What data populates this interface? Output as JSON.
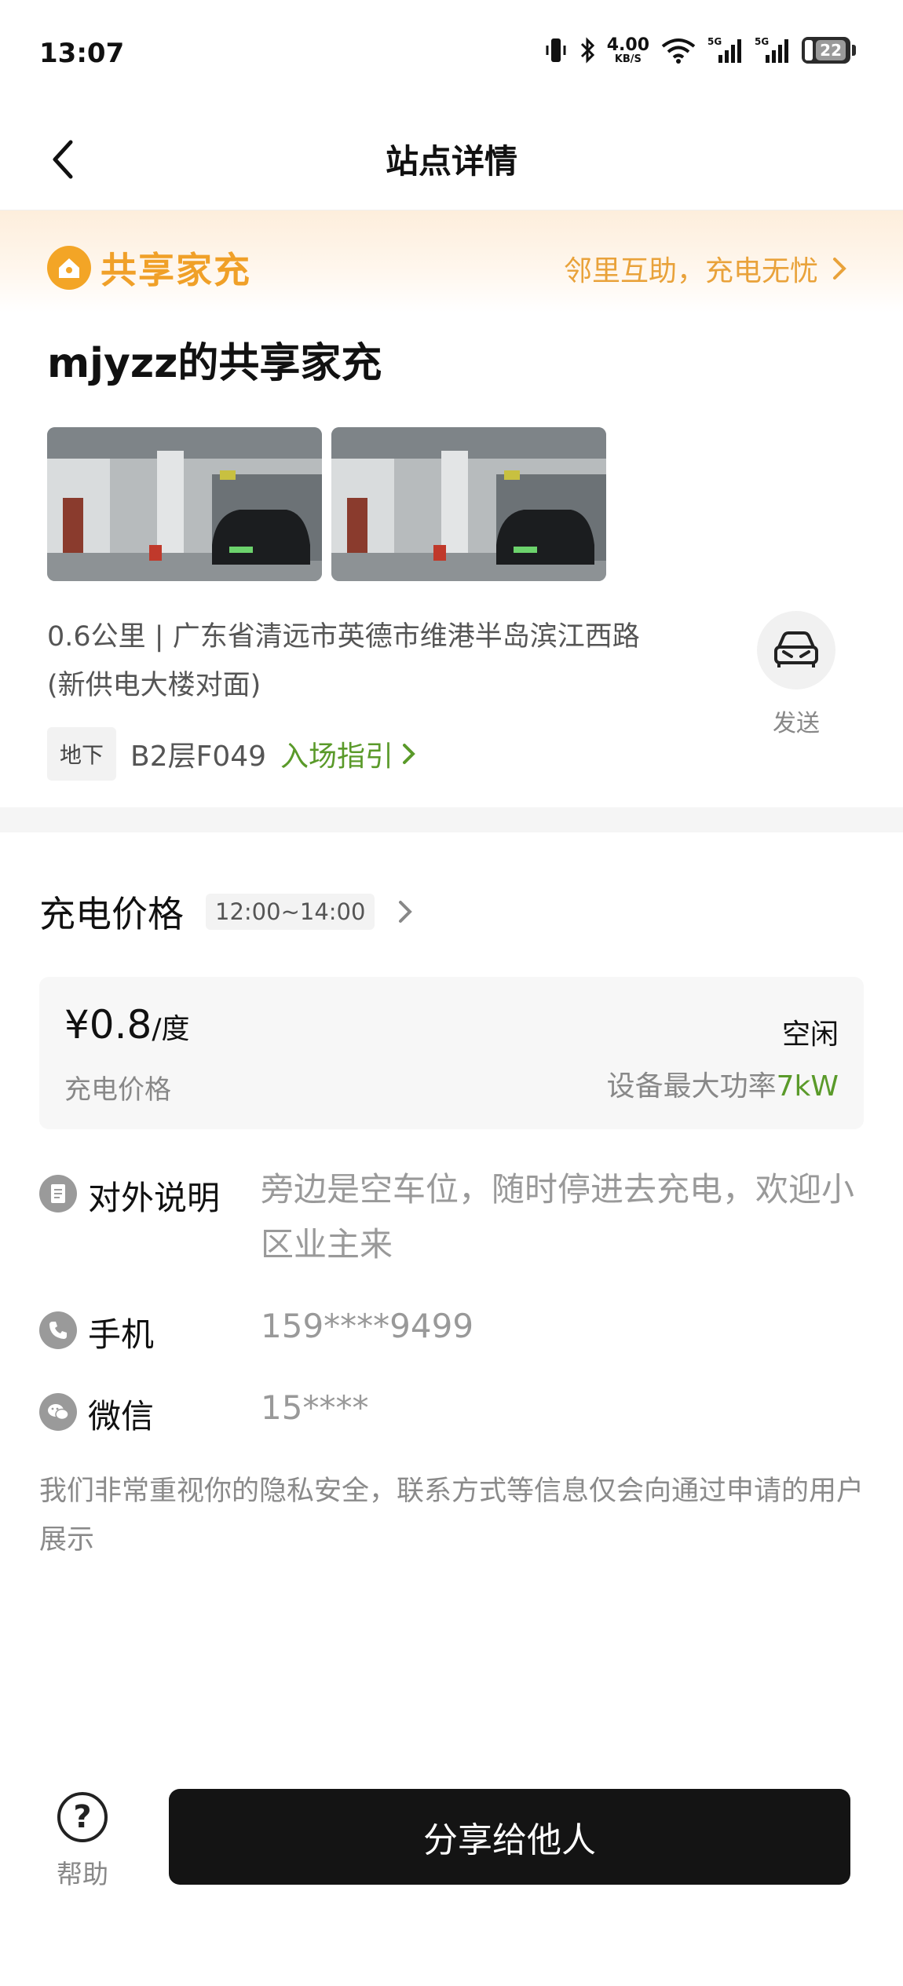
{
  "status_bar": {
    "time": "13:07",
    "net_speed_value": "4.00",
    "net_speed_unit": "KB/S",
    "signal1_label": "5G",
    "signal2_label": "5G",
    "battery_level": "22",
    "icons": [
      "vibrate-icon",
      "bluetooth-icon",
      "wifi-icon",
      "signal-icon",
      "signal-icon",
      "battery-icon"
    ]
  },
  "header": {
    "title": "站点详情",
    "back_icon": "chevron-left-icon"
  },
  "banner": {
    "brand": "共享家充",
    "slogan": "邻里互助，充电无忧",
    "brand_color": "#f0a028"
  },
  "station": {
    "name": "mjyzz的共享家充",
    "photo_count": 2,
    "address_line1": "0.6公里 | 广东省清远市英德市维港半岛滨江西路",
    "address_line2": "(新供电大楼对面)",
    "send_label": "发送",
    "floor_tag": "地下",
    "floor_value": "B2层F049",
    "entry_guide": "入场指引"
  },
  "price": {
    "section_title": "充电价格",
    "time_range": "12:00~14:00",
    "value": "¥0.8",
    "unit": "/度",
    "label": "充电价格",
    "status": "空闲",
    "power_label": "设备最大功率",
    "power_value": "7kW",
    "accent_color": "#5a9a2a"
  },
  "info": {
    "description_label": "对外说明",
    "description_value": "旁边是空车位，随时停进去充电，欢迎小区业主来",
    "phone_label": "手机",
    "phone_value": "159****9499",
    "wechat_label": "微信",
    "wechat_value": "15****"
  },
  "privacy_note": "我们非常重视你的隐私安全，联系方式等信息仅会向通过申请的用户展示",
  "bottom": {
    "help_label": "帮助",
    "share_label": "分享给他人"
  }
}
